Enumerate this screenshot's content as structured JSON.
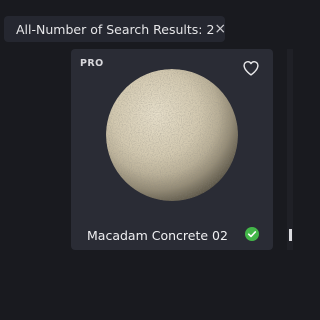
{
  "filter_chip": {
    "label": "All-Number of Search Results: 2",
    "close_glyph": "×",
    "close_icon": "close-icon"
  },
  "results": [
    {
      "badge": "PRO",
      "title": "Macadam Concrete 02",
      "favorite_icon": "heart-outline-icon",
      "downloaded_icon": "check-circle-icon",
      "downloaded_color": "#43b649",
      "preview": "concrete-sphere-preview"
    }
  ],
  "colors": {
    "background": "#191a1f",
    "chip_bg": "#252730",
    "card_bg": "#2a2c35",
    "text": "#e8e8ea"
  }
}
